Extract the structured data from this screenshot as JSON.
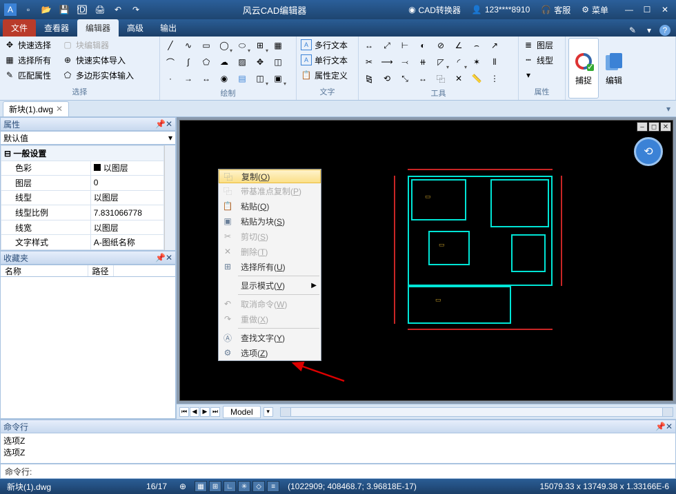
{
  "title": "风云CAD编辑器",
  "titlebar_right": {
    "converter": "CAD转换器",
    "user": "123****8910",
    "support": "客服",
    "menu": "菜单"
  },
  "tabs": {
    "file": "文件",
    "viewer": "查看器",
    "editor": "编辑器",
    "advanced": "高级",
    "output": "输出"
  },
  "ribbon": {
    "select": {
      "quick": "快速选择",
      "blockedit": "块编辑器",
      "all": "选择所有",
      "entityimport": "快速实体导入",
      "match": "匹配属性",
      "polyimport": "多边形实体输入",
      "label": "选择"
    },
    "draw_label": "绘制",
    "text": {
      "mtext": "多行文本",
      "stext": "单行文本",
      "attdef": "属性定义",
      "label": "文字"
    },
    "tools_label": "工具",
    "layer": {
      "layer": "图层",
      "linetype": "线型",
      "label": "属性"
    },
    "snap": "捕捉",
    "edit": "编辑"
  },
  "doctab": "新块(1).dwg",
  "panels": {
    "props_title": "属性",
    "combo_default": "默认值",
    "general_cat": "一般设置",
    "rows": [
      {
        "k": "色彩",
        "v": "以图层",
        "swatch": true
      },
      {
        "k": "图层",
        "v": "0"
      },
      {
        "k": "线型",
        "v": "以图层"
      },
      {
        "k": "线型比例",
        "v": "7.831066778"
      },
      {
        "k": "线宽",
        "v": "以图层"
      },
      {
        "k": "文字样式",
        "v": "A-图纸名称"
      }
    ],
    "fav_title": "收藏夹",
    "col_name": "名称",
    "col_path": "路径"
  },
  "context_menu": [
    {
      "label": "复制",
      "suffix": "(O)",
      "highlight": true,
      "icon": "copy"
    },
    {
      "label": "带基准点复制",
      "suffix": "(P)",
      "disabled": true,
      "icon": "copy-base"
    },
    {
      "label": "粘贴",
      "suffix": "(Q)",
      "icon": "paste"
    },
    {
      "label": "粘贴为块",
      "suffix": "(S)",
      "icon": "paste-block"
    },
    {
      "label": "剪切",
      "suffix": "(S)",
      "disabled": true,
      "icon": "cut"
    },
    {
      "label": "删除",
      "suffix": "(T)",
      "disabled": true,
      "icon": "delete"
    },
    {
      "label": "选择所有",
      "suffix": "(U)",
      "icon": "select-all"
    },
    {
      "sep": true
    },
    {
      "label": "显示模式",
      "suffix": "(V)",
      "submenu": true
    },
    {
      "sep": true
    },
    {
      "label": "取消命令",
      "suffix": "(W)",
      "disabled": true,
      "icon": "undo"
    },
    {
      "label": "重做",
      "suffix": "(X)",
      "disabled": true,
      "icon": "redo"
    },
    {
      "sep": true
    },
    {
      "label": "查找文字",
      "suffix": "(Y)",
      "icon": "find"
    },
    {
      "label": "选项",
      "suffix": "(Z)",
      "icon": "options"
    }
  ],
  "model_tab": "Model",
  "cmd": {
    "title": "命令行",
    "history": [
      "选项Z",
      "选项Z"
    ],
    "prompt": "命令行:"
  },
  "status": {
    "file": "新块(1).dwg",
    "page": "16/17",
    "info": "(1022909; 408468.7; 3.96818E-17)",
    "coords": "15079.33 x 13749.38 x 1.33166E-6"
  }
}
